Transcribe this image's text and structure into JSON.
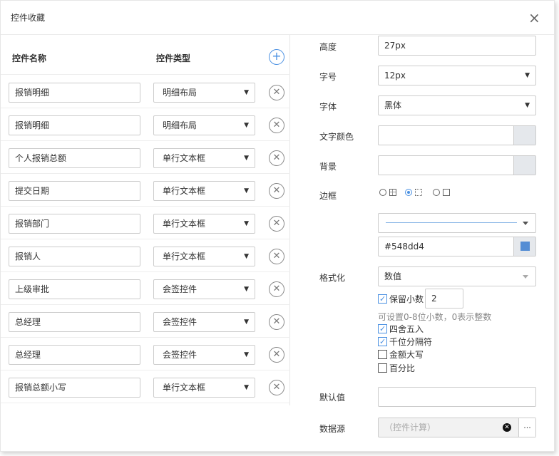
{
  "dialog": {
    "title": "控件收藏",
    "close_glyph": "×"
  },
  "list": {
    "headers": {
      "name": "控件名称",
      "type": "控件类型"
    },
    "add_glyph": "+",
    "delete_glyph": "✕",
    "rows": [
      {
        "name": "报销明细",
        "type": "明细布局"
      },
      {
        "name": "报销明细",
        "type": "明细布局"
      },
      {
        "name": "个人报销总额",
        "type": "单行文本框"
      },
      {
        "name": "提交日期",
        "type": "单行文本框"
      },
      {
        "name": "报销部门",
        "type": "单行文本框"
      },
      {
        "name": "报销人",
        "type": "单行文本框"
      },
      {
        "name": "上级审批",
        "type": "会签控件"
      },
      {
        "name": "总经理",
        "type": "会签控件"
      },
      {
        "name": "总经理",
        "type": "会签控件"
      },
      {
        "name": "报销总额小写",
        "type": "单行文本框"
      }
    ]
  },
  "props": {
    "height": {
      "label": "高度",
      "value": "27px"
    },
    "font_size": {
      "label": "字号",
      "value": "12px"
    },
    "font_face": {
      "label": "字体",
      "value": "黑体"
    },
    "text_color": {
      "label": "文字颜色",
      "value": ""
    },
    "background": {
      "label": "背景",
      "value": ""
    },
    "border": {
      "label": "边框",
      "selected_option": 2,
      "line_color": "#548dd4"
    },
    "format": {
      "label": "格式化",
      "value": "数值",
      "keep_decimal": {
        "label": "保留小数",
        "checked": true,
        "value": "2"
      },
      "hint": "可设置0-8位小数，0表示整数",
      "round": {
        "label": "四舍五入",
        "checked": true
      },
      "thousands": {
        "label": "千位分隔符",
        "checked": true
      },
      "uppercase": {
        "label": "金额大写",
        "checked": false
      },
      "percent": {
        "label": "百分比",
        "checked": false
      }
    },
    "default_value": {
      "label": "默认值",
      "value": ""
    },
    "data_source": {
      "label": "数据源",
      "value": "（控件计算）",
      "more_label": "..."
    }
  },
  "colors": {
    "accent": "#4a90e2",
    "border_line": "#548dd4"
  }
}
